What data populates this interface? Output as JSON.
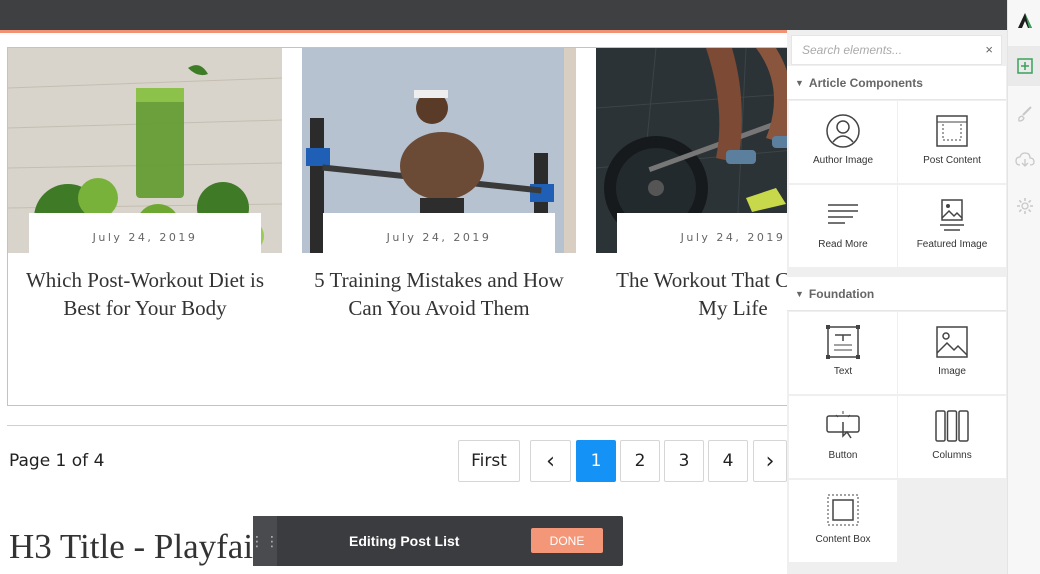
{
  "posts": [
    {
      "date": "July 24, 2019",
      "title": "Which Post-Workout Diet is Best for Your Body"
    },
    {
      "date": "July 24, 2019",
      "title": "5 Training Mistakes and How Can You Avoid Them"
    },
    {
      "date": "July 24, 2019",
      "title": "The Workout That Changed My Life"
    }
  ],
  "pagination": {
    "page_label": "Page 1 of 4",
    "first": "First",
    "prev": "‹",
    "pages": [
      "1",
      "2",
      "3",
      "4"
    ],
    "next": "›",
    "active_page": "1"
  },
  "heading": {
    "visible_text": "H3 Title - Playfai"
  },
  "edit_bar": {
    "label": "Editing Post List",
    "done": "DONE"
  },
  "panel": {
    "search_placeholder": "Search elements...",
    "clear": "×",
    "sections": [
      {
        "title": "Article Components",
        "items": [
          {
            "label": "Author Image",
            "icon": "author-image-icon"
          },
          {
            "label": "Post Content",
            "icon": "post-content-icon"
          },
          {
            "label": "Read More",
            "icon": "read-more-icon"
          },
          {
            "label": "Featured Image",
            "icon": "featured-image-icon"
          }
        ]
      },
      {
        "title": "Foundation",
        "items": [
          {
            "label": "Text",
            "icon": "text-icon"
          },
          {
            "label": "Image",
            "icon": "image-icon"
          },
          {
            "label": "Button",
            "icon": "button-icon"
          },
          {
            "label": "Columns",
            "icon": "columns-icon"
          },
          {
            "label": "Content Box",
            "icon": "content-box-icon"
          }
        ]
      }
    ]
  },
  "rail": [
    "logo-icon",
    "add-element-icon",
    "brush-icon",
    "cloud-download-icon",
    "gear-icon"
  ],
  "colors": {
    "accent": "#f29275",
    "active_page": "#1592f5",
    "topbar": "#3f4042",
    "done_button": "#f49779",
    "add_icon": "#3aa15a"
  }
}
